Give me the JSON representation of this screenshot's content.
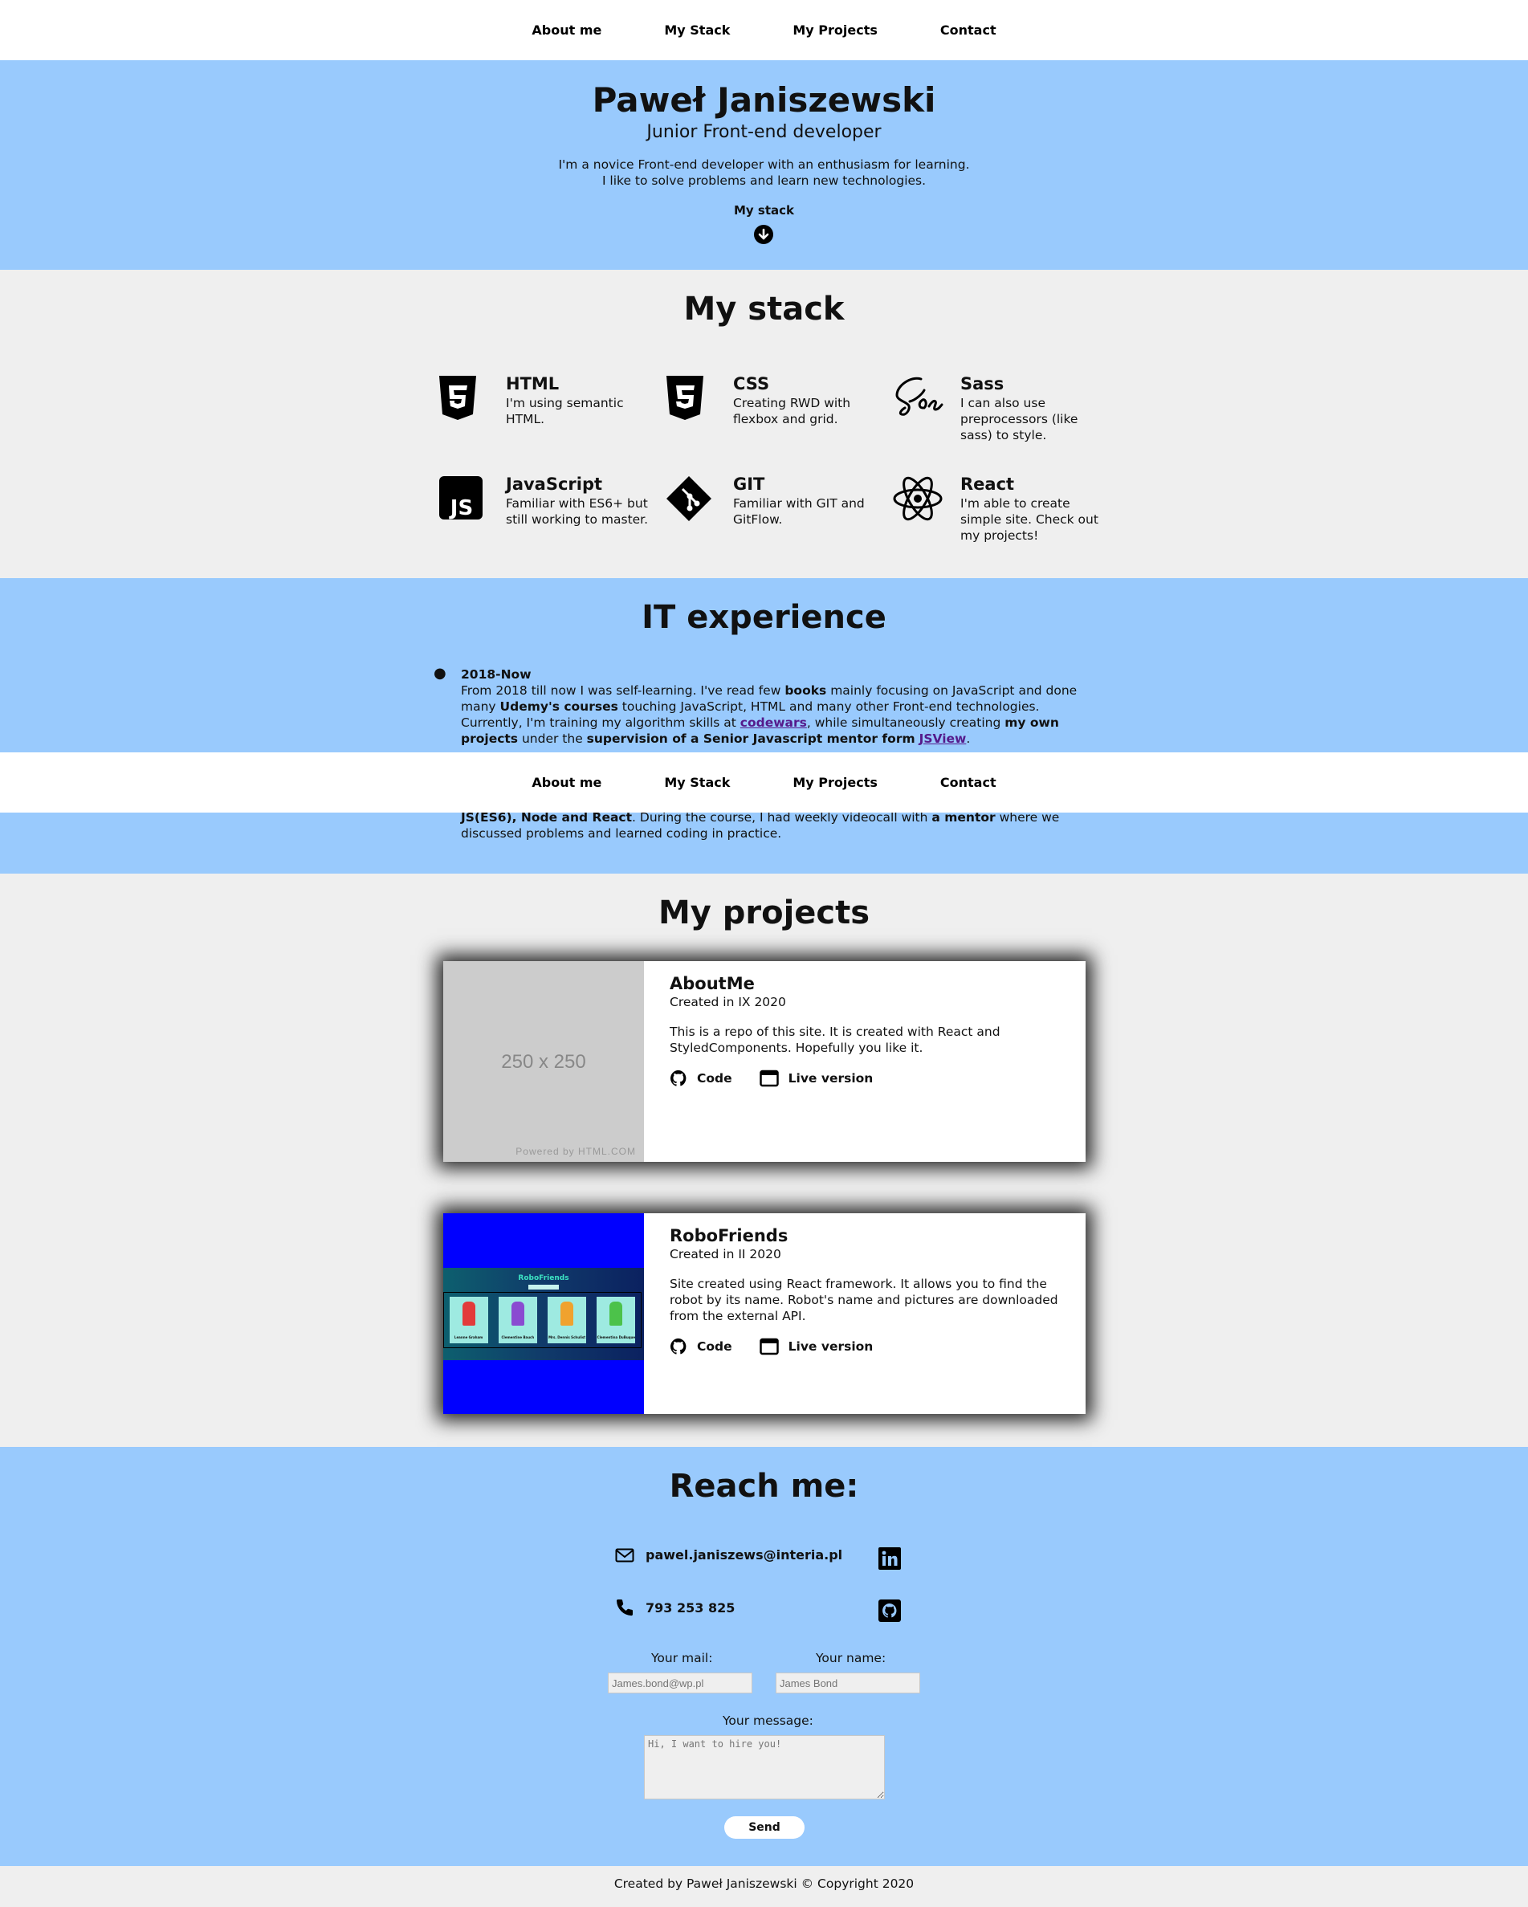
{
  "nav": {
    "items": [
      "About me",
      "My Stack",
      "My Projects",
      "Contact"
    ]
  },
  "hero": {
    "name": "Paweł Janiszewski",
    "role": "Junior Front-end developer",
    "intro_1": "I'm a novice Front-end developer with an enthusiasm for learning.",
    "intro_2": "I like to solve problems and learn new technologies.",
    "stack_link": "My stack"
  },
  "stack": {
    "title": "My stack",
    "items": [
      {
        "name": "HTML",
        "desc": "I'm using semantic HTML.",
        "icon": "html5-icon"
      },
      {
        "name": "CSS",
        "desc": "Creating RWD with flexbox and grid.",
        "icon": "css3-icon"
      },
      {
        "name": "Sass",
        "desc": "I can also use preprocessors (like sass) to style.",
        "icon": "sass-icon"
      },
      {
        "name": "JavaScript",
        "desc": "Familiar with ES6+ but still working to master.",
        "icon": "js-icon"
      },
      {
        "name": "GIT",
        "desc": "Familiar with GIT and GitFlow.",
        "icon": "git-icon"
      },
      {
        "name": "React",
        "desc": "I'm able to create simple site. Check out my projects!",
        "icon": "react-icon"
      }
    ]
  },
  "experience": {
    "title": "IT experience",
    "period": "2018-Now",
    "p1_a": "From 2018 till now I was self-learning. I've read few ",
    "p1_books": "books",
    "p1_b": " mainly focusing on JavaScript and done many ",
    "p1_udemy": "Udemy's courses",
    "p1_c": " touching JavaScript, HTML and many other Front-end technologies. Currently, I'm training my algorithm skills at ",
    "p1_codewars": "codewars",
    "p1_d": ", while simultaneously creating ",
    "p1_own": "my own projects",
    "p1_e": " under the ",
    "p1_sup": "supervision of a Senior Javascript mentor form",
    "p1_jsview": "JSView",
    "p1_f": ".",
    "p2_tech": "JS(ES6), Node and React",
    "p2_a": ". During the course, I had weekly videocall with ",
    "p2_mentor": "a mentor",
    "p2_b": " where we discussed problems and learned coding in practice."
  },
  "projects": {
    "title": "My projects",
    "items": [
      {
        "name": "AboutMe",
        "created": "Created in IX 2020",
        "desc": "This is a repo of this site. It is created with React and StyledComponents. Hopefully you like it.",
        "code": "Code",
        "live": "Live version",
        "placeholder_text": "250 x 250",
        "placeholder_credit": "Powered by HTML.COM"
      },
      {
        "name": "RoboFriends",
        "created": "Created in II 2020",
        "desc": "Site created using React framework. It allows you to find the robot by its name. Robot's name and pictures are downloaded from the external API.",
        "code": "Code",
        "live": "Live version",
        "shot_title": "RoboFriends",
        "robots": [
          "Leanne Graham",
          "Clementine Bauch",
          "Mrs. Dennis Schulist",
          "Clementina DuBuque"
        ]
      }
    ]
  },
  "contact": {
    "title": "Reach me:",
    "email": "pawel.janiszews@interia.pl",
    "phone": "793 253 825",
    "mail_label": "Your mail:",
    "mail_placeholder": "James.bond@wp.pl",
    "name_label": "Your name:",
    "name_placeholder": "James Bond",
    "message_label": "Your message:",
    "message_placeholder": "Hi, I want to hire you!",
    "send": "Send"
  },
  "footer": {
    "text": "Created by Paweł Janiszewski © Copyright 2020"
  },
  "colors": {
    "blue_band": "#99cafd",
    "grey_band": "#efefef",
    "robo_blue": "#0000ff"
  }
}
